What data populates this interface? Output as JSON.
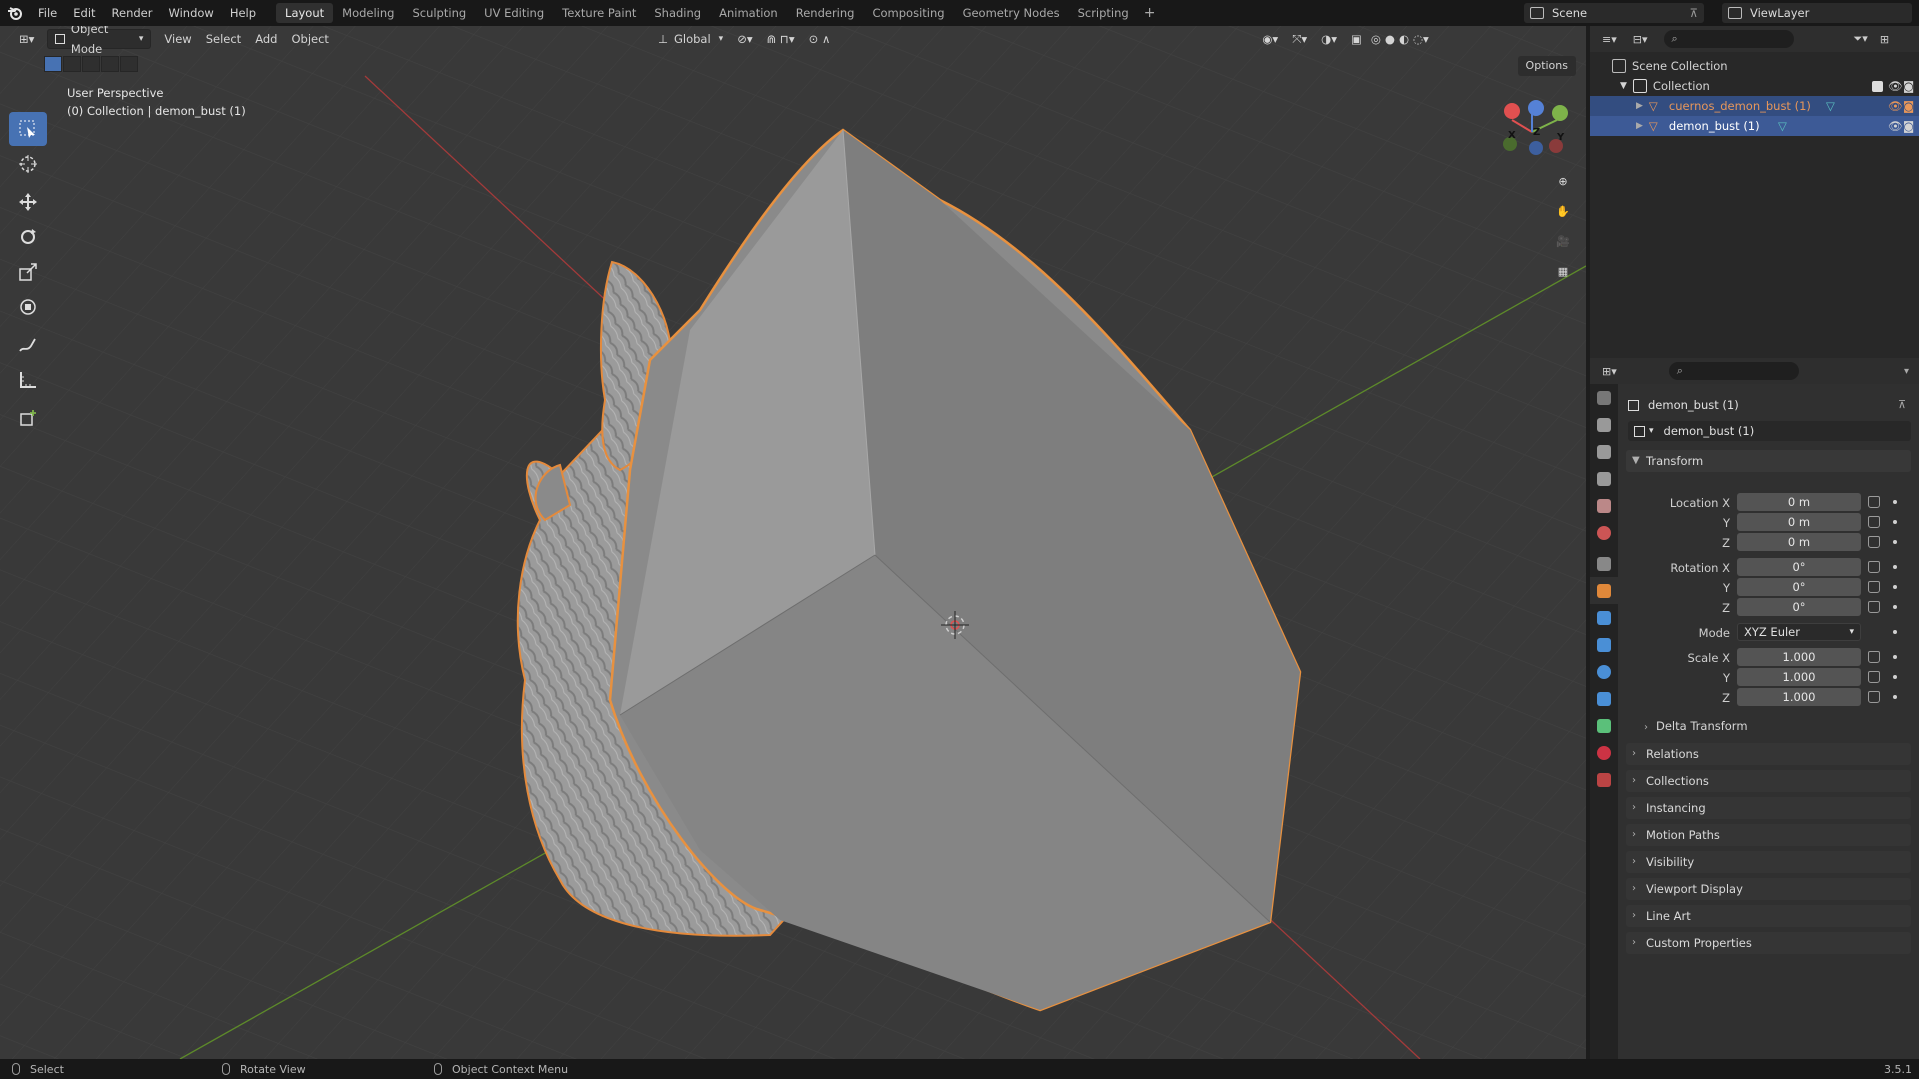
{
  "menu": [
    "File",
    "Edit",
    "Render",
    "Window",
    "Help"
  ],
  "workspaces": [
    "Layout",
    "Modeling",
    "Sculpting",
    "UV Editing",
    "Texture Paint",
    "Shading",
    "Animation",
    "Rendering",
    "Compositing",
    "Geometry Nodes",
    "Scripting"
  ],
  "active_workspace": "Layout",
  "scene": "Scene",
  "view_layer": "ViewLayer",
  "viewport": {
    "mode": "Object Mode",
    "menus": [
      "View",
      "Select",
      "Add",
      "Object"
    ],
    "orientation": "Global",
    "options": "Options",
    "perspective": "User Perspective",
    "collection_info": "(0) Collection | demon_bust (1)",
    "gizmo": {
      "x": "X",
      "y": "Y",
      "z": "Z"
    }
  },
  "outliner": {
    "root": "Scene Collection",
    "collection": "Collection",
    "objects": [
      "cuernos_demon_bust (1)",
      "demon_bust (1)"
    ]
  },
  "properties": {
    "object_name": "demon_bust (1)",
    "datablock": "demon_bust (1)",
    "transform": {
      "title": "Transform",
      "location_label": "Location X",
      "location": [
        "0 m",
        "0 m",
        "0 m"
      ],
      "rotation_label": "Rotation X",
      "rotation": [
        "0°",
        "0°",
        "0°"
      ],
      "mode_label": "Mode",
      "mode": "XYZ Euler",
      "scale_label": "Scale X",
      "scale": [
        "1.000",
        "1.000",
        "1.000"
      ],
      "y": "Y",
      "z": "Z"
    },
    "delta": "Delta Transform",
    "panels": [
      "Relations",
      "Collections",
      "Instancing",
      "Motion Paths",
      "Visibility",
      "Viewport Display",
      "Line Art",
      "Custom Properties"
    ]
  },
  "status": {
    "select": "Select",
    "rotate": "Rotate View",
    "context": "Object Context Menu",
    "version": "3.5.1"
  }
}
